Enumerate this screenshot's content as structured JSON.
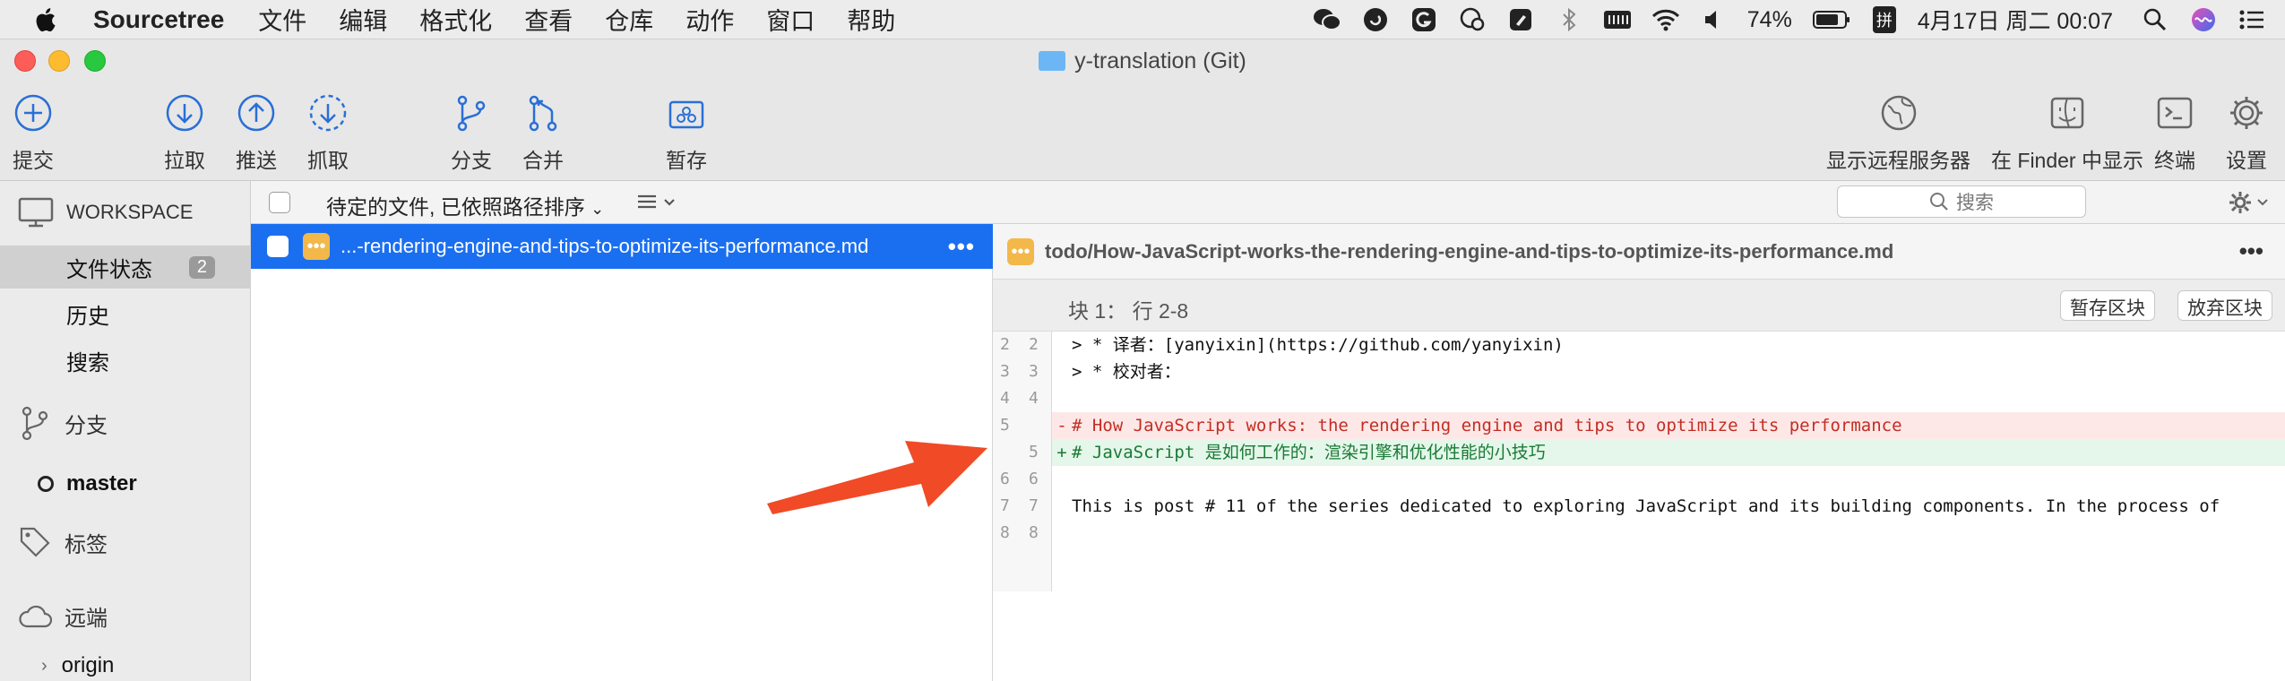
{
  "menubar": {
    "app_name": "Sourcetree",
    "items": [
      "文件",
      "编辑",
      "格式化",
      "查看",
      "仓库",
      "动作",
      "窗口",
      "帮助"
    ],
    "battery": "74%",
    "datetime": "4月17日 周二 00:07",
    "input_method": "拼"
  },
  "window": {
    "title": "y-translation (Git)"
  },
  "toolbar": {
    "commit": "提交",
    "pull": "拉取",
    "push": "推送",
    "fetch": "抓取",
    "branch": "分支",
    "merge": "合并",
    "stash": "暂存",
    "show_remote": "显示远程服务器",
    "show_in_finder": "在 Finder 中显示",
    "terminal": "终端",
    "settings": "设置"
  },
  "sidebar": {
    "workspace_header": "WORKSPACE",
    "file_status": "文件状态",
    "file_status_count": "2",
    "history": "历史",
    "search": "搜索",
    "branches": "分支",
    "current_branch": "master",
    "tags": "标签",
    "remotes": "远端",
    "origin": "origin"
  },
  "filepane": {
    "sort_label": "待定的文件, 已依照路径排序",
    "search_placeholder": "搜索",
    "selected_file": "...-rendering-engine-and-tips-to-optimize-its-performance.md"
  },
  "diff": {
    "file_path": "todo/How-JavaScript-works-the-rendering-engine-and-tips-to-optimize-its-performance.md",
    "hunk_title": "块 1： 行 2-8",
    "stage_hunk": "暂存区块",
    "discard_hunk": "放弃区块",
    "lines": [
      {
        "old": "2",
        "new": "2",
        "type": "ctx",
        "marker": " ",
        "text": "> * 译者：[yanyixin](https://github.com/yanyixin)"
      },
      {
        "old": "3",
        "new": "3",
        "type": "ctx",
        "marker": " ",
        "text": "> * 校对者："
      },
      {
        "old": "4",
        "new": "4",
        "type": "ctx",
        "marker": " ",
        "text": ""
      },
      {
        "old": "5",
        "new": "",
        "type": "del",
        "marker": "-",
        "text": "# How JavaScript works: the rendering engine and tips to optimize its performance"
      },
      {
        "old": "",
        "new": "5",
        "type": "add",
        "marker": "+",
        "text": "# JavaScript 是如何工作的：渲染引擎和优化性能的小技巧"
      },
      {
        "old": "6",
        "new": "6",
        "type": "ctx",
        "marker": " ",
        "text": ""
      },
      {
        "old": "7",
        "new": "7",
        "type": "ctx",
        "marker": " ",
        "text": "This is post # 11 of the series dedicated to exploring JavaScript and its building components. In the process of"
      },
      {
        "old": "8",
        "new": "8",
        "type": "ctx",
        "marker": " ",
        "text": ""
      }
    ]
  },
  "colors": {
    "selection_blue": "#1a6ff0",
    "annotation_arrow": "#f04a27",
    "toolbar_icon_blue": "#2a6fd6",
    "modified_badge": "#f3b84a"
  }
}
